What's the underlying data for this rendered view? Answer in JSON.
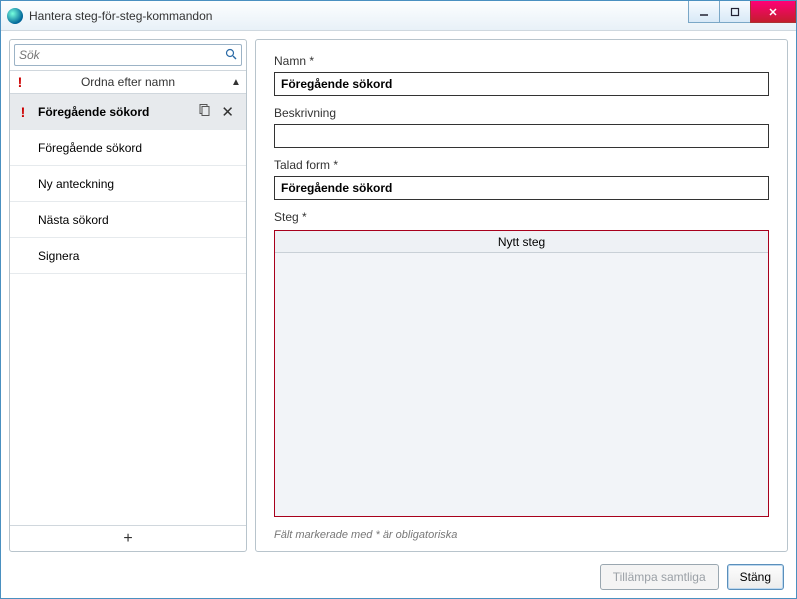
{
  "window": {
    "title": "Hantera steg-för-steg-kommandon"
  },
  "sidebar": {
    "search_placeholder": "Sök",
    "sort_label": "Ordna efter namn",
    "items": [
      {
        "label": "Föregående sökord",
        "selected": true,
        "warn": true
      },
      {
        "label": "Föregående sökord",
        "selected": false,
        "warn": false
      },
      {
        "label": "Ny anteckning",
        "selected": false,
        "warn": false
      },
      {
        "label": "Nästa sökord",
        "selected": false,
        "warn": false
      },
      {
        "label": "Signera",
        "selected": false,
        "warn": false
      }
    ],
    "add_label": "+"
  },
  "form": {
    "name_label": "Namn *",
    "name_value": "Föregående sökord",
    "desc_label": "Beskrivning",
    "desc_value": "",
    "spoken_label": "Talad form *",
    "spoken_value": "Föregående sökord",
    "steps_label": "Steg *",
    "new_step_label": "Nytt steg",
    "hint": "Fält markerade med * är obligatoriska"
  },
  "footer": {
    "apply_all": "Tillämpa samtliga",
    "close": "Stäng"
  }
}
